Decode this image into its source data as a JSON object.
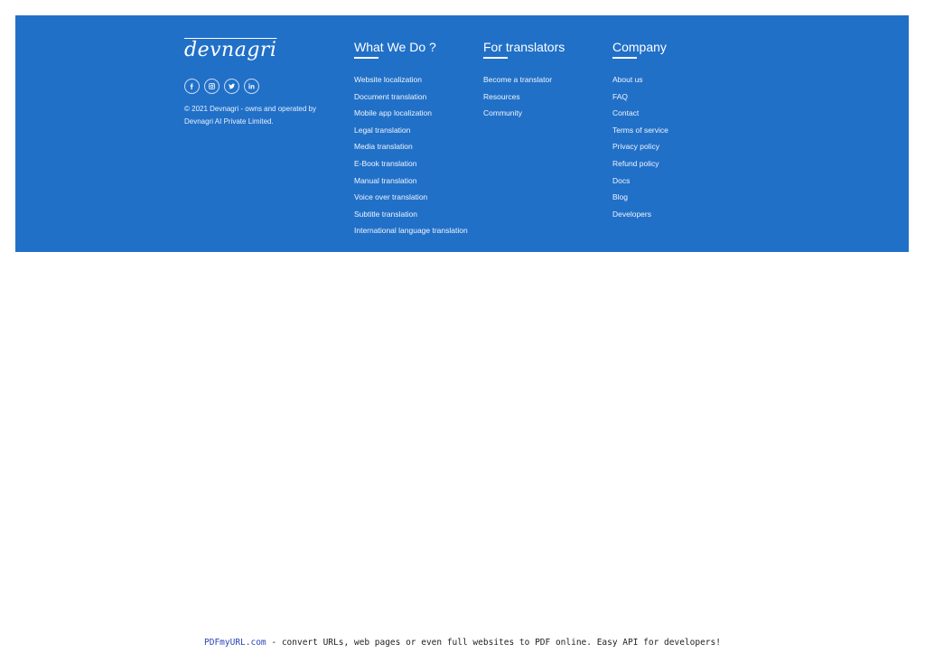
{
  "brand": {
    "logo_text": "devnagri",
    "socials": [
      {
        "name": "facebook",
        "icon": "facebook-icon"
      },
      {
        "name": "instagram",
        "icon": "instagram-icon"
      },
      {
        "name": "twitter",
        "icon": "twitter-icon"
      },
      {
        "name": "linkedin",
        "icon": "linkedin-icon"
      }
    ],
    "copyright_line1": "© 2021 Devnagri - owns and operated by",
    "copyright_line2": "Devnagri AI Private Limited."
  },
  "what_we_do": {
    "heading": "What We Do ?",
    "links": [
      "Website localization",
      "Document translation",
      "Mobile app localization",
      "Legal translation",
      "Media translation",
      "E-Book translation",
      "Manual translation",
      "Voice over translation",
      "Subtitle translation",
      "International language translation"
    ]
  },
  "for_translators": {
    "heading": "For translators",
    "links": [
      "Become a translator",
      "Resources",
      "Community"
    ]
  },
  "company": {
    "heading": "Company",
    "links": [
      "About us",
      "FAQ",
      "Contact",
      "Terms of service",
      "Privacy policy",
      "Refund policy",
      "Docs",
      "Blog",
      "Developers"
    ]
  },
  "pdf_banner": {
    "link_text": "PDFmyURL.com",
    "rest_text": " - convert URLs, web pages or even full websites to PDF online. Easy API for developers!"
  },
  "colors": {
    "footer_bg": "#2170c8",
    "text": "#ffffff",
    "link": "#2a45b8"
  }
}
